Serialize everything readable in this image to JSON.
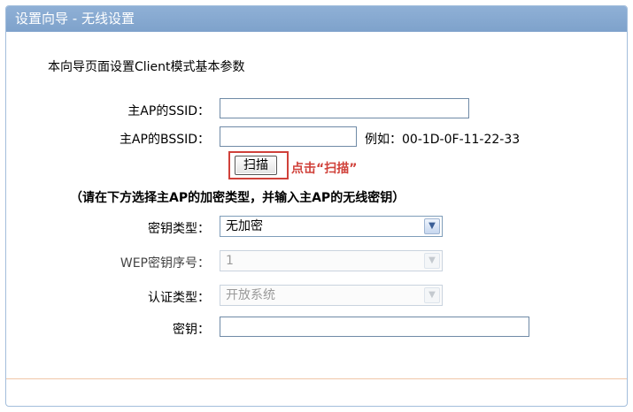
{
  "window": {
    "title": "设置向导 - 无线设置"
  },
  "intro": "本向导页面设置Client模式基本参数",
  "ssid": {
    "label": "主AP的SSID：",
    "value": ""
  },
  "bssid": {
    "label": "主AP的BSSID：",
    "value": "",
    "example": "例如：00-1D-0F-11-22-33"
  },
  "scan": {
    "label": "扫描",
    "hint": "点击“扫描”"
  },
  "note": "（请在下方选择主AP的加密类型，并输入主AP的无线密钥）",
  "key_type": {
    "label": "密钥类型：",
    "selected": "无加密"
  },
  "wep_index": {
    "label": "WEP密钥序号：",
    "selected": "1"
  },
  "auth_type": {
    "label": "认证类型：",
    "selected": "开放系统"
  },
  "key": {
    "label": "密钥：",
    "value": ""
  },
  "colors": {
    "title_bar": "#7ea2cb",
    "hint_red": "#d0413a",
    "border_blue": "#a3bedc"
  }
}
